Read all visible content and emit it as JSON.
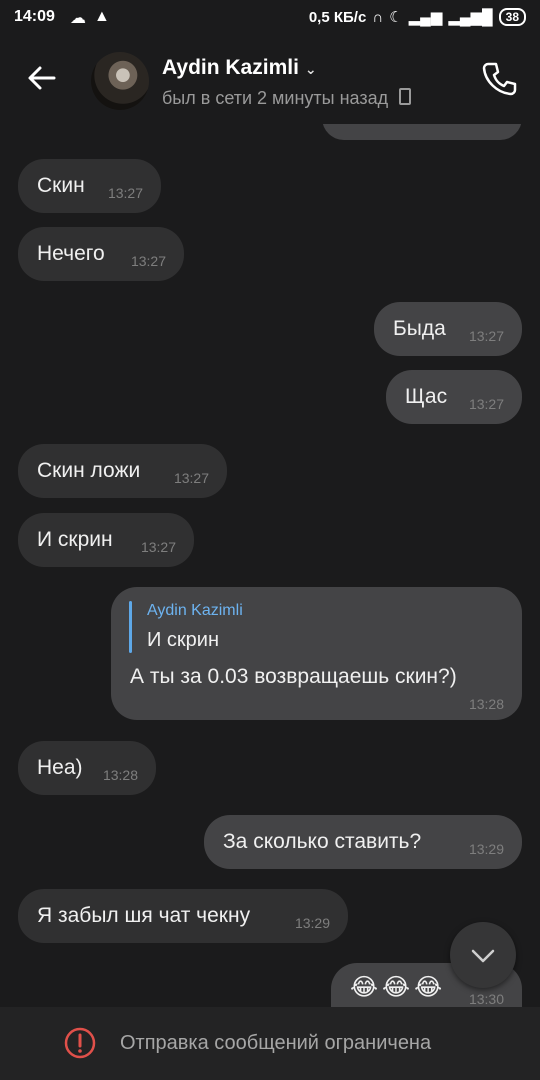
{
  "status_bar": {
    "time": "14:09",
    "network_speed": "0,5 КБ/с",
    "battery": "38"
  },
  "header": {
    "contact_name": "Aydin Kazimli",
    "status": "был в сети 2 минуты назад"
  },
  "messages": [
    {
      "direction": "in",
      "text": "Скин",
      "time": "13:27"
    },
    {
      "direction": "in",
      "text": "Нечего",
      "time": "13:27"
    },
    {
      "direction": "out",
      "text": "Быда",
      "time": "13:27"
    },
    {
      "direction": "out",
      "text": "Щас",
      "time": "13:27"
    },
    {
      "direction": "in",
      "text": "Скин ложи",
      "time": "13:27"
    },
    {
      "direction": "in",
      "text": "И скрин",
      "time": "13:27"
    },
    {
      "direction": "out",
      "reply_to_name": "Aydin Kazimli",
      "reply_to_text": "И скрин",
      "text": "А ты за 0.03 возвращаешь скин?)",
      "time": "13:28"
    },
    {
      "direction": "in",
      "text": "Неа)",
      "time": "13:28"
    },
    {
      "direction": "out",
      "text": "За сколько ставить?",
      "time": "13:29"
    },
    {
      "direction": "in",
      "text": "Я забыл шя чат чекну",
      "time": "13:29"
    },
    {
      "direction": "out",
      "text": "😂😂😂",
      "time": "13:30"
    }
  ],
  "footer": {
    "restriction_text": "Отправка сообщений ограничена"
  },
  "colors": {
    "background": "#1b1b1c",
    "incoming_bubble": "#303031",
    "outgoing_bubble": "#444446",
    "reply_accent": "#5ea8e8",
    "warning": "#e0504a"
  }
}
